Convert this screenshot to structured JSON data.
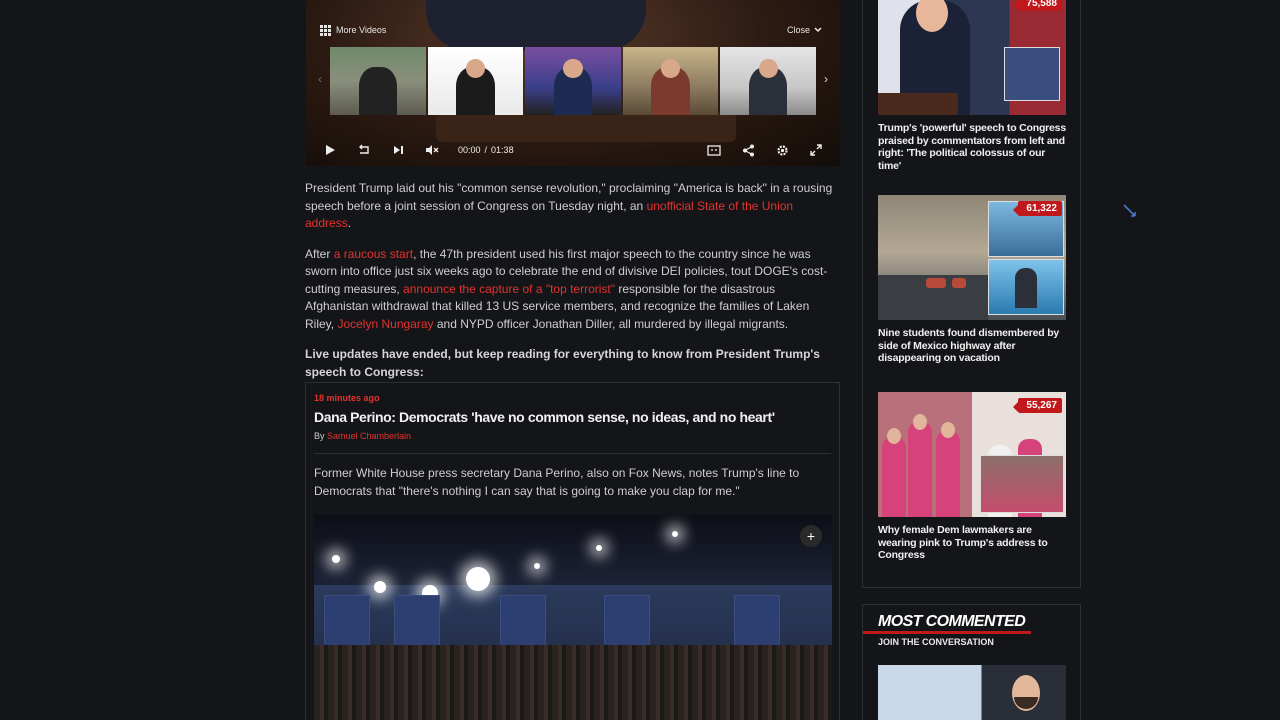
{
  "player": {
    "more_videos_label": "More Videos",
    "close_label": "Close",
    "current_time": "00:00",
    "time_separator": "/",
    "duration": "01:38"
  },
  "article": {
    "p1_text": "President Trump laid out his \"common sense revolution,\" proclaiming \"America is back\" in a rousing speech before a joint session of Congress on Tuesday night, an ",
    "p1_link": "unofficial State of the Union address",
    "p1_end": ".",
    "p2_a": "After ",
    "p2_link1": "a raucous start",
    "p2_b": ", the 47th president used his first major speech to the country since he was sworn into office just six weeks ago to celebrate the end of divisive DEI policies, tout DOGE's cost-cutting measures, ",
    "p2_link2": "announce the capture of a \"top terrorist\"",
    "p2_c": " responsible for the disastrous Afghanistan withdrawal that killed 13 US service members, and recognize the families of Laken Riley, ",
    "p2_link3": "Jocelyn Nungaray",
    "p2_d": " and NYPD officer Jonathan Diller, all murdered by illegal migrants.",
    "p3_bold": "Live updates have ended, but keep reading for everything to know from President Trump's speech to Congress:"
  },
  "live_update": {
    "time_ago": "18 minutes ago",
    "headline": "Dana Perino: Democrats 'have no common sense, no ideas, and no heart'",
    "by_prefix": "By ",
    "author": "Samuel Chamberlain",
    "body": "Former White House press secretary Dana Perino, also on Fox News, notes Trump's line to Democrats that \"there's nothing I can say that is going to make you clap for me.\""
  },
  "sidebar": {
    "cards": [
      {
        "title": "Trump's 'powerful' speech to Congress praised by commentators from left and right: 'The political colossus of our time'",
        "count": "75,588"
      },
      {
        "title": "Nine students found dismembered by side of Mexico highway after disappearing on vacation",
        "count": "61,322"
      },
      {
        "title": "Why female Dem lawmakers are wearing pink to Trump's address to Congress",
        "count": "55,267"
      }
    ]
  },
  "most_commented": {
    "heading": "MOST COMMENTED",
    "sub": "JOIN THE CONVERSATION"
  },
  "colors": {
    "accent_red": "#e3332e",
    "badge_red": "#c0181b",
    "page_bg": "#141518"
  },
  "icons": [
    "grid-icon",
    "chevron-down-icon",
    "chevron-left-icon",
    "chevron-right-icon",
    "play-icon",
    "replay-10-icon",
    "skip-next-icon",
    "mute-icon",
    "captions-icon",
    "share-icon",
    "settings-gear-icon",
    "fullscreen-icon",
    "expand-plus-icon",
    "mouse-cursor-icon"
  ]
}
